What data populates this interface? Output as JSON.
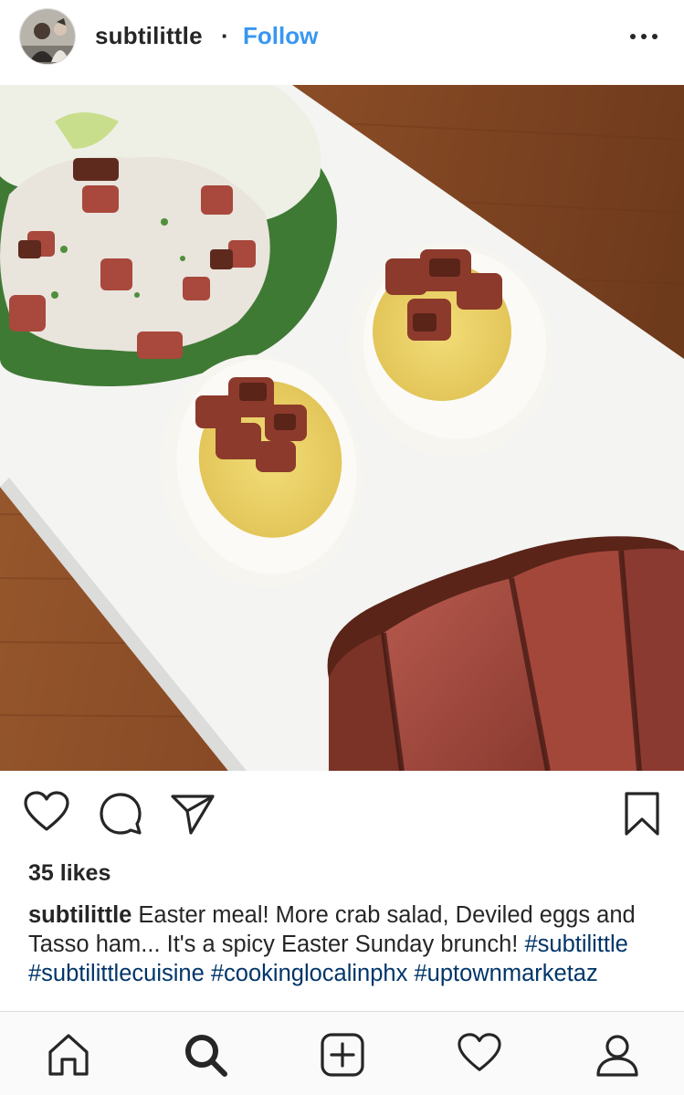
{
  "post": {
    "username": "subtilittle",
    "separator": "·",
    "follow_label": "Follow",
    "likes_text": "35 likes",
    "caption": {
      "username": "subtilittle",
      "text": " Easter meal! More crab salad, Deviled eggs and Tasso ham... It's a spicy Easter Sunday brunch! ",
      "hashtags": [
        "#subtilittle",
        "#subtilittlecuisine",
        "#cookinglocalinphx",
        "#uptownmarketaz"
      ]
    }
  },
  "icons": {
    "more": "more-options-icon",
    "like": "heart-icon",
    "comment": "comment-icon",
    "share": "paper-plane-icon",
    "save": "bookmark-icon",
    "home": "home-icon",
    "search": "search-icon",
    "add": "add-post-icon",
    "activity": "heart-icon",
    "profile": "profile-icon"
  },
  "colors": {
    "follow": "#3897f0",
    "hashtag": "#003569",
    "text": "#262626",
    "nav_bg": "#fafafa"
  }
}
